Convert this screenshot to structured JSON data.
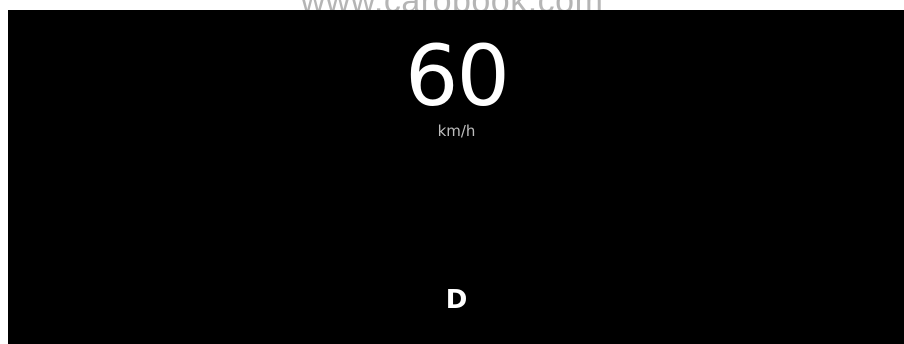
{
  "watermark": "www.carobook.com",
  "display": {
    "speed": "60",
    "unit": "km/h",
    "gear": "D"
  },
  "colors": {
    "background": "#000000",
    "primary_text": "#ffffff",
    "secondary_text": "#bdbdbd",
    "watermark": "#b5b5b5"
  }
}
